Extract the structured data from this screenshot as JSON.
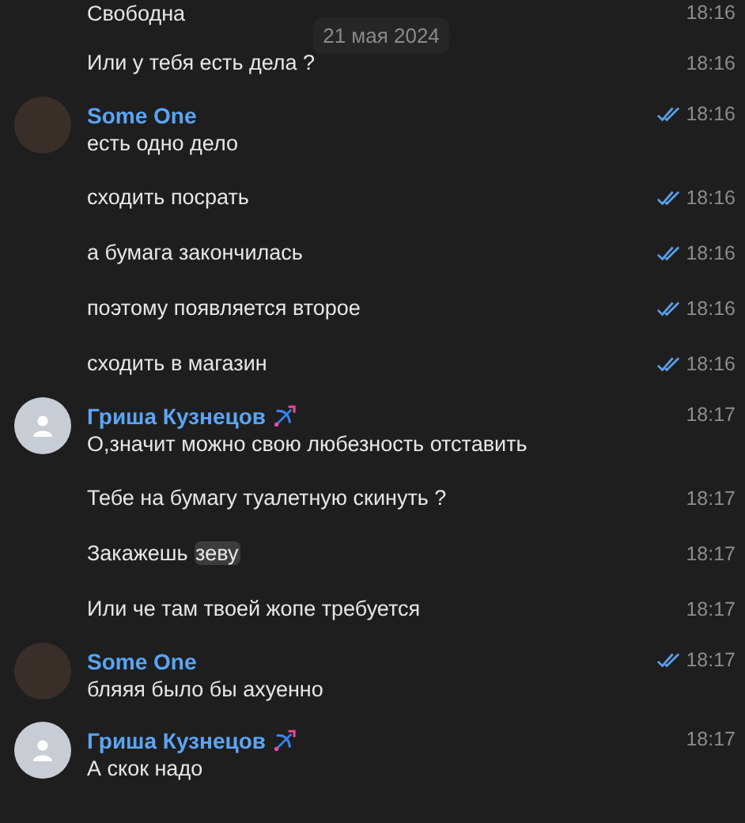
{
  "date_badge": "21 мая 2024",
  "groups": [
    {
      "messages": [
        {
          "text": "Свободна",
          "time": "18:16",
          "read": false
        },
        {
          "text": "Или у тебя есть дела ?",
          "time": "18:16",
          "read": false
        }
      ]
    },
    {
      "author": "Some One",
      "avatar": {
        "kind": "photo"
      },
      "status_icon": false,
      "messages": [
        {
          "text": "есть одно дело",
          "time": "18:16",
          "read": true
        },
        {
          "text": "сходить посрать",
          "time": "18:16",
          "read": true
        },
        {
          "text": "а бумага закончилась",
          "time": "18:16",
          "read": true
        },
        {
          "text": "поэтому появляется второе",
          "time": "18:16",
          "read": true
        },
        {
          "text": "сходить в магазин",
          "time": "18:16",
          "read": true
        }
      ]
    },
    {
      "author": "Гриша Кузнецов",
      "avatar": {
        "kind": "default"
      },
      "status_icon": true,
      "messages": [
        {
          "text": "О,значит можно свою любезность отставить",
          "time": "18:17",
          "read": false
        },
        {
          "text": "Тебе на бумагу туалетную скинуть ?",
          "time": "18:17",
          "read": false
        },
        {
          "text": "Закажешь",
          "highlighted": "зеву",
          "time": "18:17",
          "read": false
        },
        {
          "text": "Или че там твоей жопе требуется",
          "time": "18:17",
          "read": false
        }
      ]
    },
    {
      "author": "Some One",
      "avatar": {
        "kind": "photo"
      },
      "status_icon": false,
      "messages": [
        {
          "text": "бляяя было бы ахуенно",
          "time": "18:17",
          "read": true
        }
      ]
    },
    {
      "author": "Гриша Кузнецов",
      "avatar": {
        "kind": "default"
      },
      "status_icon": true,
      "messages": [
        {
          "text": "А скок надо",
          "time": "18:17",
          "read": false
        }
      ]
    }
  ]
}
